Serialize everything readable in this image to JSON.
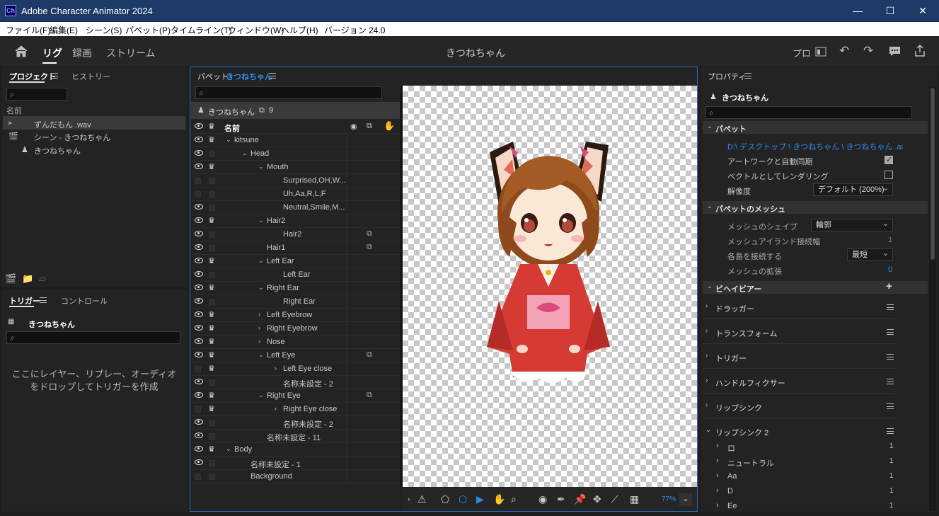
{
  "window": {
    "app_icon": "Ch",
    "title": "Adobe Character Animator 2024",
    "min": "—",
    "max": "☐",
    "close": "✕"
  },
  "menu": [
    "ファイル(F)",
    "編集(E)",
    "シーン(S)",
    "パペット(P)",
    "タイムライン(T)",
    "ウィンドウ(W)",
    "ヘルプ(H)",
    "バージョン 24.0"
  ],
  "workspaces": {
    "home": "home-icon",
    "rig": "リグ",
    "record": "録画",
    "stream": "ストリーム"
  },
  "doc_title": "きつねちゃん",
  "topright": {
    "pro": "プロ"
  },
  "project": {
    "tabs": [
      "プロジェクト",
      "ヒストリー"
    ],
    "col_name": "名前",
    "items": [
      "ずんだもん .wav",
      "シーン - きつねちゃん",
      "きつねちゃん"
    ]
  },
  "triggers": {
    "tabs": [
      "トリガー",
      "コントロール"
    ],
    "puppet": "きつねちゃん",
    "hint1": "ここにレイヤー、リプレー、オーディオ",
    "hint2": "をドロップしてトリガーを作成"
  },
  "puppet_panel": {
    "title_prefix": "パペット :",
    "title_name": "きつねちゃん",
    "header_name": "きつねちゃん",
    "header_count": "9",
    "col_name": "名前",
    "zoom": "77%"
  },
  "layers": [
    {
      "name": "kitsune",
      "indent": 0,
      "arrow": "open",
      "eye": true,
      "crown": true,
      "tag": false
    },
    {
      "name": "Head",
      "indent": 1,
      "arrow": "open",
      "eye": true,
      "crown": false,
      "tag": false
    },
    {
      "name": "Mouth",
      "indent": 2,
      "arrow": "open",
      "eye": true,
      "crown": true,
      "tag": false
    },
    {
      "name": "Surprised,OH,W...",
      "indent": 3,
      "arrow": "",
      "eye": false,
      "crown": false,
      "tag": false
    },
    {
      "name": "Uh,Aa,R,L,F",
      "indent": 3,
      "arrow": "",
      "eye": false,
      "crown": false,
      "tag": false
    },
    {
      "name": "Neutral,Smile,M...",
      "indent": 3,
      "arrow": "",
      "eye": true,
      "crown": false,
      "tag": false
    },
    {
      "name": "Hair2",
      "indent": 2,
      "arrow": "open",
      "eye": true,
      "crown": true,
      "tag": false
    },
    {
      "name": "Hair2",
      "indent": 3,
      "arrow": "",
      "eye": true,
      "crown": false,
      "tag": true
    },
    {
      "name": "Hair1",
      "indent": 2,
      "arrow": "",
      "eye": true,
      "crown": false,
      "tag": true
    },
    {
      "name": "Left Ear",
      "indent": 2,
      "arrow": "open",
      "eye": true,
      "crown": true,
      "tag": false
    },
    {
      "name": "Left Ear",
      "indent": 3,
      "arrow": "",
      "eye": true,
      "crown": false,
      "tag": false
    },
    {
      "name": "Right Ear",
      "indent": 2,
      "arrow": "open",
      "eye": true,
      "crown": true,
      "tag": false
    },
    {
      "name": "Right Ear",
      "indent": 3,
      "arrow": "",
      "eye": true,
      "crown": false,
      "tag": false
    },
    {
      "name": "Left Eyebrow",
      "indent": 2,
      "arrow": "closed",
      "eye": true,
      "crown": true,
      "tag": false
    },
    {
      "name": "Right Eyebrow",
      "indent": 2,
      "arrow": "closed",
      "eye": true,
      "crown": true,
      "tag": false
    },
    {
      "name": "Nose",
      "indent": 2,
      "arrow": "closed",
      "eye": true,
      "crown": true,
      "tag": false
    },
    {
      "name": "Left Eye",
      "indent": 2,
      "arrow": "open",
      "eye": true,
      "crown": true,
      "tag": true
    },
    {
      "name": "Left Eye close",
      "indent": 3,
      "arrow": "closed",
      "eye": false,
      "crown": true,
      "tag": false
    },
    {
      "name": "名称未設定 - 2",
      "indent": 3,
      "arrow": "",
      "eye": true,
      "crown": false,
      "tag": false
    },
    {
      "name": "Right Eye",
      "indent": 2,
      "arrow": "open",
      "eye": true,
      "crown": true,
      "tag": true
    },
    {
      "name": "Right Eye close",
      "indent": 3,
      "arrow": "closed",
      "eye": false,
      "crown": true,
      "tag": false
    },
    {
      "name": "名称未設定 - 2",
      "indent": 3,
      "arrow": "",
      "eye": true,
      "crown": false,
      "tag": false
    },
    {
      "name": "名称未設定 - 11",
      "indent": 2,
      "arrow": "",
      "eye": true,
      "crown": false,
      "tag": false
    },
    {
      "name": "Body",
      "indent": 0,
      "arrow": "open",
      "eye": true,
      "crown": true,
      "tag": false
    },
    {
      "name": "名称未設定 - 1",
      "indent": 1,
      "arrow": "",
      "eye": true,
      "crown": false,
      "tag": false
    },
    {
      "name": "Background",
      "indent": 1,
      "arrow": "",
      "eye": false,
      "crown": false,
      "tag": false
    }
  ],
  "properties": {
    "tab": "プロパティ",
    "puppet": "きつねちゃん",
    "sec_puppet": "パペット",
    "path": "D:\\ デスクトップ \\ きつねちゃん \\ きつねちゃん .ai",
    "sync": "アートワークと自動同期",
    "vector": "ベクトルとしてレンダリング",
    "resolution_label": "解像度",
    "resolution_value": "デフォルト (200%)",
    "sec_mesh": "パペットのメッシュ",
    "mesh_shape_label": "メッシュのシェイプ",
    "mesh_shape_value": "輪郭",
    "island_label": "メッシュアイランド接続幅",
    "island_value": "1",
    "connect_label": "各島を接続する",
    "connect_value": "最短",
    "expand_label": "メッシュの拡張",
    "expand_value": "0",
    "sec_behaviors": "ビヘイビアー",
    "behaviors": [
      "ドラッガー",
      "トランスフォーム",
      "トリガー",
      "ハンドルフィクサー",
      "リップシンク",
      "リップシンク 2"
    ],
    "lipsync_items": [
      {
        "name": "ロ",
        "val": "1"
      },
      {
        "name": "ニュートラル",
        "val": "1"
      },
      {
        "name": "Aa",
        "val": "1"
      },
      {
        "name": "D",
        "val": "1"
      },
      {
        "name": "Ee",
        "val": "1"
      }
    ]
  }
}
